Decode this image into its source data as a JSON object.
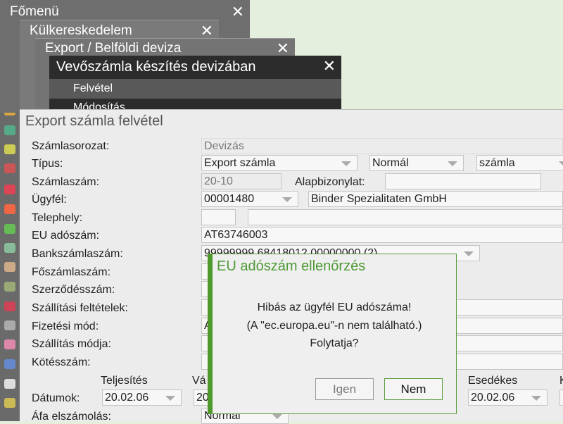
{
  "windows": {
    "fomenu": "Főmenü",
    "kulker": "Külkereskedelem",
    "export": "Export / Belföldi deviza",
    "vevo": "Vevőszámla készítés devizában",
    "menu_items": [
      "Felvétel",
      "Módosítás"
    ],
    "close": "✕"
  },
  "form": {
    "title": "Export számla felvétel",
    "labels": [
      "Számlasorozat:",
      "Típus:",
      "Számlaszám:",
      "Ügyfél:",
      "Telephely:",
      "EU adószám:",
      "Bankszámlaszám:",
      "Főszámlaszám:",
      "Szerződésszám:",
      "Szállítási feltételek:",
      "Fizetési mód:",
      "Szállítás módja:",
      "Kötésszám:",
      "Dátumok:",
      "Áfa elszámolás:"
    ],
    "szamlasorozat": "Devizás",
    "tipus": "Export számla",
    "tipus2": "Normál",
    "tipus3": "számla",
    "szamlaszam": "20-10",
    "alapbizonylat_label": "Alapbizonylat:",
    "alapbizonylat": "",
    "ugyfel_code": "00001480",
    "ugyfel_name": "Binder Spezialitaten GmbH",
    "eu_adoszam": "AT63746003",
    "bankszamla": "99999999 68418012 00000000 (2)",
    "fizetesi_partial": "A",
    "teljesites_label": "Teljesítés",
    "vas_label": "Vá",
    "esedekes_label": "Esedékes",
    "k_label": "K",
    "teljesites": "20.02.06",
    "vas_partial": "20",
    "esedekes": "20.02.06",
    "afa": "Normál"
  },
  "dialog": {
    "title": "EU adószám ellenőrzés",
    "lines": [
      "Hibás az ügyfél EU adószáma!",
      "(A \"ec.europa.eu\"-n nem található.)",
      "Folytatja?"
    ],
    "yes": "Igen",
    "no": "Nem"
  },
  "colors": {
    "accent": "#4f9a2c",
    "background": "#e4f0dd"
  }
}
